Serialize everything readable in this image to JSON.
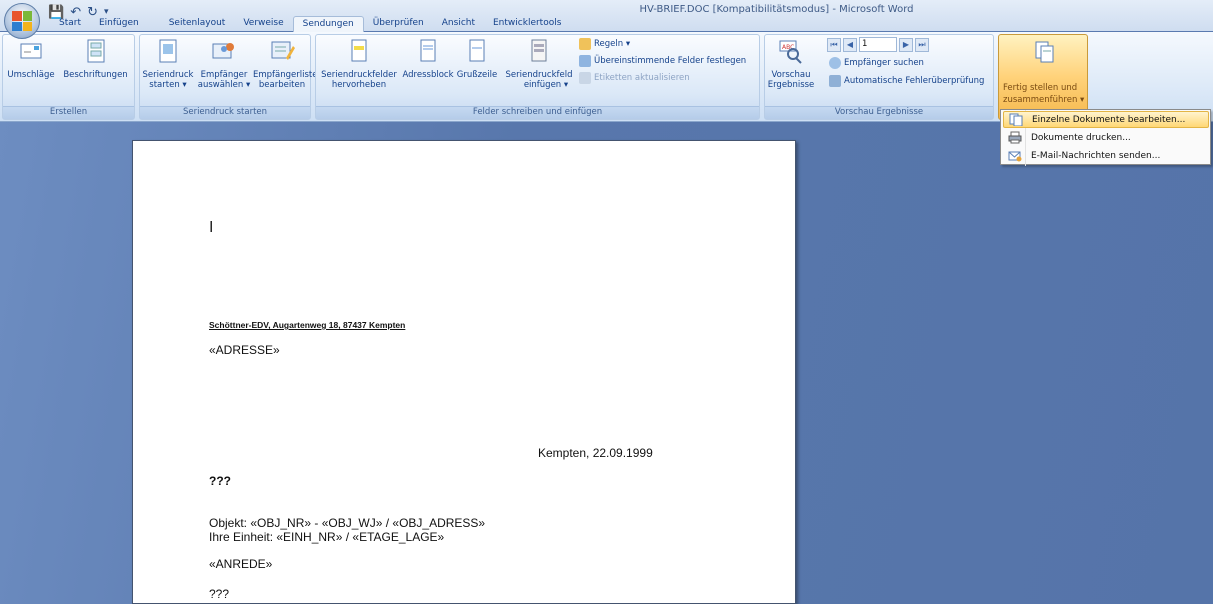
{
  "window": {
    "title": "HV-BRIEF.DOC [Kompatibilitätsmodus] - Microsoft Word"
  },
  "tabs": [
    "Start",
    "Einfügen",
    "Seitenlayout",
    "Verweise",
    "Sendungen",
    "Überprüfen",
    "Ansicht",
    "Entwicklertools"
  ],
  "active_tab": "Sendungen",
  "ribbon": {
    "erstellen": {
      "label": "Erstellen",
      "umschlaege": "Umschläge",
      "beschriftungen": "Beschriftungen"
    },
    "seriendruck_starten": {
      "label": "Seriendruck starten",
      "seriendruck_l1": "Seriendruck",
      "seriendruck_l2": "starten ▾",
      "empfaenger_l1": "Empfänger",
      "empfaenger_l2": "auswählen ▾",
      "liste_l1": "Empfängerliste",
      "liste_l2": "bearbeiten"
    },
    "felder": {
      "label": "Felder schreiben und einfügen",
      "hervorheben_l1": "Seriendruckfelder",
      "hervorheben_l2": "hervorheben",
      "adressblock": "Adressblock",
      "grusszeile": "Grußzeile",
      "feld_l1": "Seriendruckfeld",
      "feld_l2": "einfügen ▾",
      "regeln": "Regeln ▾",
      "uebereinstimmende": "Übereinstimmende Felder festlegen",
      "etiketten": "Etiketten aktualisieren"
    },
    "vorschau": {
      "label": "Vorschau Ergebnisse",
      "vorschau_l1": "Vorschau",
      "vorschau_l2": "Ergebnisse",
      "record": "1",
      "empfaenger_suchen": "Empfänger suchen",
      "fehlerpruefung": "Automatische Fehlerüberprüfung"
    },
    "fertig": {
      "label_l1": "Fertig stellen und",
      "label_l2": "zusammenführen ▾"
    }
  },
  "menu": {
    "items": [
      "Einzelne Dokumente bearbeiten...",
      "Dokumente drucken...",
      "E-Mail-Nachrichten senden..."
    ],
    "highlighted": 0
  },
  "document": {
    "cursor": "I",
    "sender": "Schöttner-EDV, Augartenweg 18, 87437 Kempten",
    "adresse": "«ADRESSE»",
    "date": "Kempten, 22.09.1999",
    "q1": "???",
    "objekt": "Objekt: «OBJ_NR» - «OBJ_WJ» / «OBJ_ADRESS»",
    "einheit": "Ihre Einheit: «EINH_NR» / «ETAGE_LAGE»",
    "anrede": "«ANREDE»",
    "q2": "???"
  },
  "colors": {
    "ribbon_text": "#15428b",
    "workspace": "#5a7ab0",
    "highlight": "#ffd775"
  }
}
